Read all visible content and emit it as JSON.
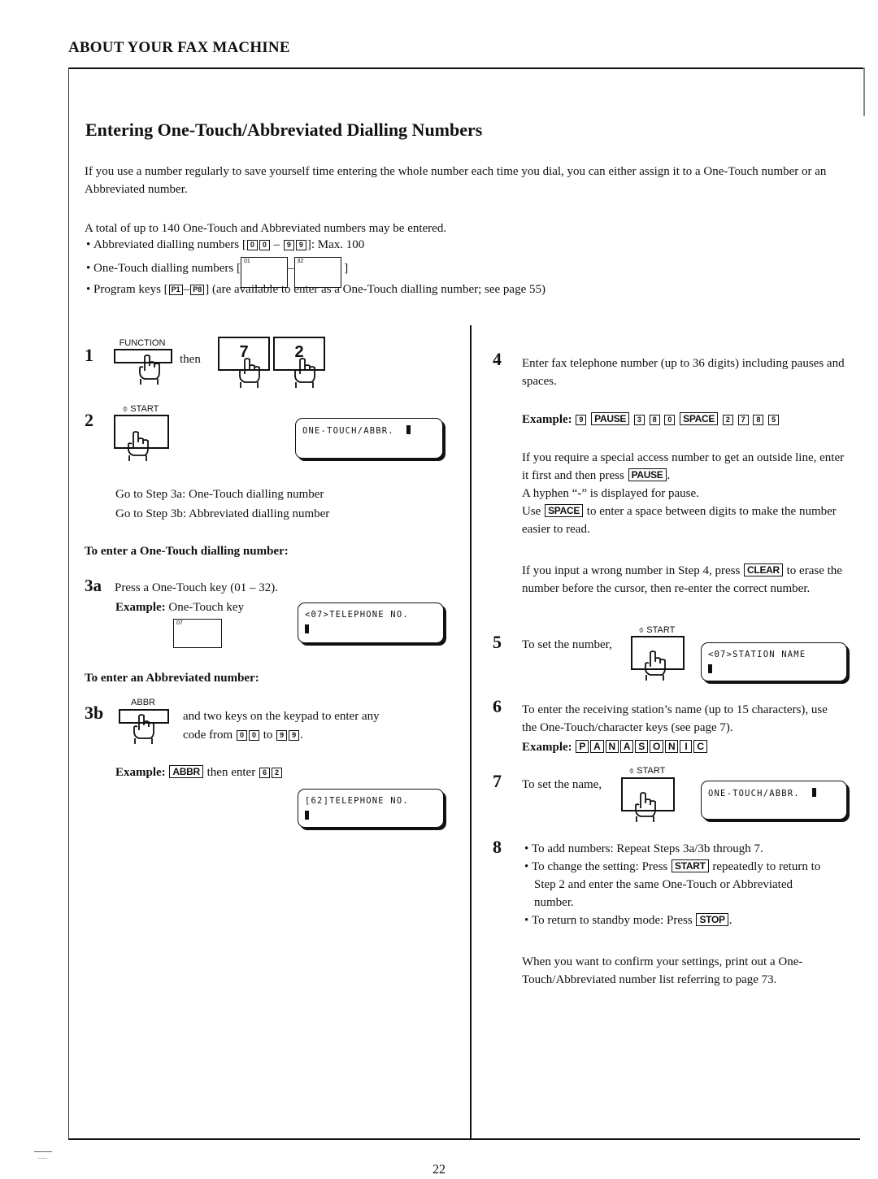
{
  "section_header": "ABOUT YOUR FAX MACHINE",
  "page_title": "Entering One-Touch/Abbreviated Dialling Numbers",
  "intro": "If you use a number regularly to save yourself time entering the whole number each time you dial, you can either assign it to a One-Touch number or an Abbreviated number.",
  "total_note": "A total of up to 140 One-Touch and Abbreviated numbers may be entered.",
  "bullets": {
    "abbr": {
      "prefix": "Abbreviated dialling numbers [",
      "keys_start": [
        "0",
        "0"
      ],
      "dash": "–",
      "keys_end": [
        "9",
        "9"
      ],
      "suffix": "]: Max. 100"
    },
    "onetouch": {
      "prefix": "One-Touch dialling numbers [",
      "key_start": "01",
      "dash": "–",
      "key_end": "32",
      "suffix": "]"
    },
    "program": {
      "prefix": "Program keys [",
      "key_start": "P1",
      "dash": "–",
      "key_end": "P8",
      "suffix": "] (are available to enter as a One-Touch dialling number; see page 55)"
    }
  },
  "steps": {
    "s1": {
      "num": "1",
      "function_label": "FUNCTION",
      "then": "then",
      "keys": [
        "7",
        "2"
      ]
    },
    "s2": {
      "num": "2",
      "start_label": "⌽ START",
      "lcd_line1": "ONE-TOUCH/ABBR.",
      "goto_a": "Go to Step 3a: One-Touch dialling number",
      "goto_b": "Go to Step 3b: Abbreviated dialling number"
    },
    "s3a": {
      "heading": "To enter a One-Touch dialling number:",
      "num": "3a",
      "text": "Press a One-Touch key (01 – 32).",
      "example": "Example:",
      "example_text": "One-Touch key",
      "key": "07",
      "lcd_line1": "<07>TELEPHONE NO."
    },
    "s3b": {
      "heading": "To enter an Abbreviated number:",
      "num": "3b",
      "abbr_label": "ABBR",
      "text1": "and two keys on the keypad to enter any",
      "text2_prefix": "code from",
      "keys_from": [
        "0",
        "0"
      ],
      "to": "to",
      "keys_to": [
        "9",
        "9"
      ],
      "text2_suffix": ".",
      "example": "Example:",
      "example_key": "ABBR",
      "then_enter": "then enter",
      "example_digits": [
        "6",
        "2"
      ],
      "lcd_line1": "[62]TELEPHONE NO."
    },
    "s4": {
      "num": "4",
      "text": "Enter fax telephone number (up to 36 digits) including pauses and spaces.",
      "example": "Example:",
      "example_keys": [
        "9",
        "PAUSE",
        "3",
        "8",
        "0",
        "SPACE",
        "2",
        "7",
        "8",
        "5"
      ],
      "note1_a": "If you require a special access number to get an outside line, enter it first and then press",
      "note1_key": "PAUSE",
      "note1_b": ".",
      "note2": "A hyphen “-” is displayed for pause.",
      "note3_a": "Use",
      "note3_key": "SPACE",
      "note3_b": "to enter a space between digits to make the number easier to read.",
      "note4_a": "If you input a wrong number in Step 4, press",
      "note4_key": "CLEAR",
      "note4_b": "to erase the number before the cursor, then re-enter the correct number."
    },
    "s5": {
      "num": "5",
      "text": "To set the number,",
      "start_label": "⌽ START",
      "lcd_line1": "<07>STATION NAME"
    },
    "s6": {
      "num": "6",
      "text": "To enter the receiving station’s name (up to 15 characters), use the One-Touch/character keys (see page 7).",
      "example": "Example:",
      "example_keys": [
        "P",
        "A",
        "N",
        "A",
        "S",
        "O",
        "N",
        "I",
        "C"
      ]
    },
    "s7": {
      "num": "7",
      "text": "To set the name,",
      "start_label": "⌽ START",
      "lcd_line1": "ONE-TOUCH/ABBR."
    },
    "s8": {
      "num": "8",
      "b1": "To add numbers:  Repeat Steps 3a/3b through 7.",
      "b2_a": "To change the setting:  Press",
      "b2_key": "START",
      "b2_b": "repeatedly to return to Step 2 and enter the same One-Touch or Abbreviated number.",
      "b3_a": "To return to standby mode:  Press",
      "b3_key": "STOP",
      "b3_b": ".",
      "confirm": "When you want to confirm your settings, print out a One-Touch/Abbreviated number list referring to page 73."
    }
  },
  "page_number": "22"
}
